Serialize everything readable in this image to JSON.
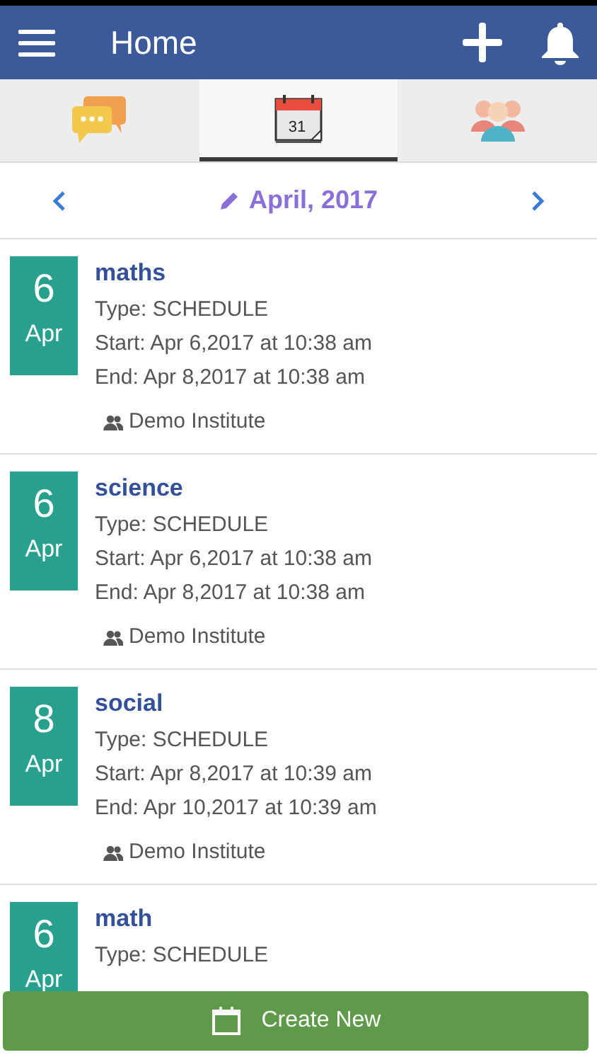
{
  "header": {
    "title": "Home"
  },
  "tabs": [
    {
      "kind": "chat",
      "selected": false
    },
    {
      "kind": "calendar",
      "selected": true,
      "day": "31"
    },
    {
      "kind": "people",
      "selected": false
    }
  ],
  "month_nav": {
    "label": "April, 2017"
  },
  "events": [
    {
      "day": "6",
      "month": "Apr",
      "title": "maths",
      "type": "Type: SCHEDULE",
      "start": "Start: Apr 6,2017 at 10:38 am",
      "end": "End: Apr 8,2017 at 10:38 am",
      "institute": "Demo Institute"
    },
    {
      "day": "6",
      "month": "Apr",
      "title": "science",
      "type": "Type: SCHEDULE",
      "start": "Start: Apr 6,2017 at 10:38 am",
      "end": "End: Apr 8,2017 at 10:38 am",
      "institute": "Demo Institute"
    },
    {
      "day": "8",
      "month": "Apr",
      "title": "social",
      "type": "Type: SCHEDULE",
      "start": "Start: Apr 8,2017 at 10:39 am",
      "end": "End: Apr 10,2017 at 10:39 am",
      "institute": "Demo Institute"
    },
    {
      "day": "6",
      "month": "Apr",
      "title": "math",
      "type": "Type: SCHEDULE"
    }
  ],
  "create_button": {
    "label": "Create New"
  }
}
